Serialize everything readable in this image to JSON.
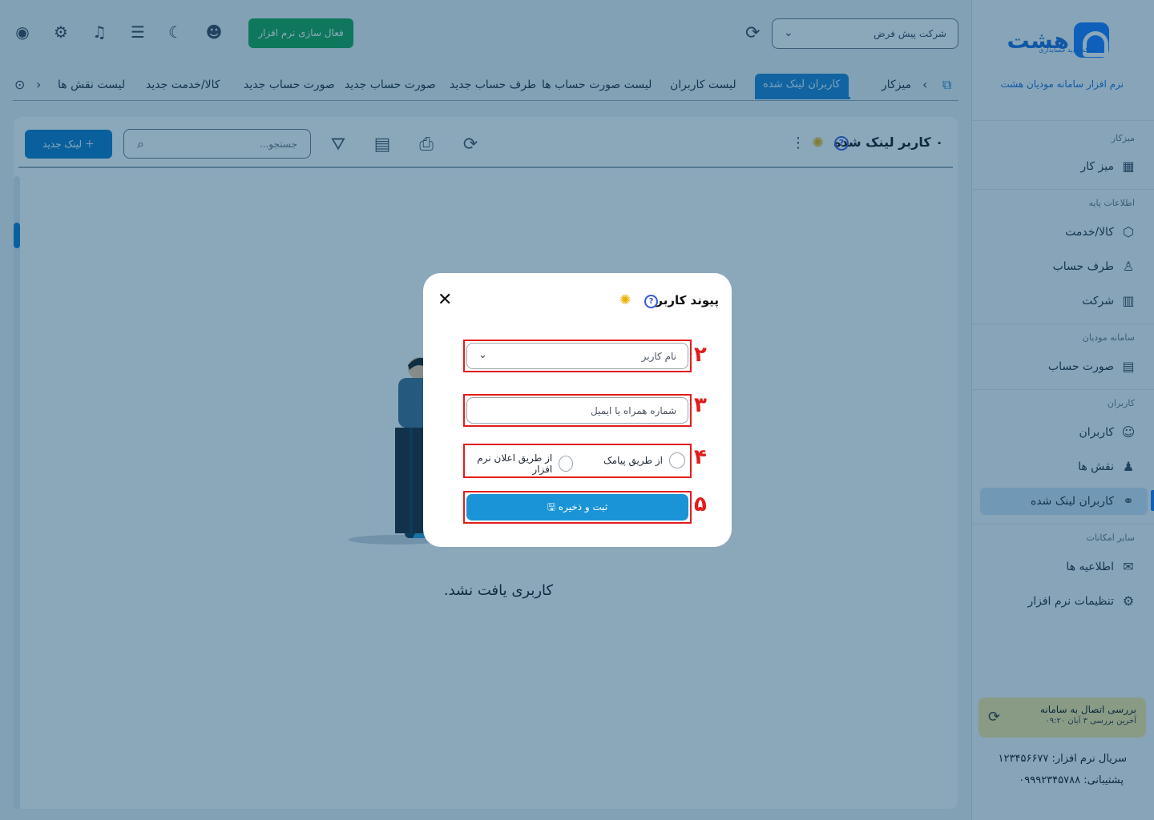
{
  "sidebar": {
    "brand_text": "هشت",
    "brand_sub": "شبکه جدید حسابداری",
    "tagline": "نرم افزار سامانه مودیان هشت",
    "sections": {
      "desk": "میزکار",
      "base": "اطلاعات پایه",
      "moadian": "سامانه مودیان",
      "users": "کاربران",
      "other": "سایر امکانات"
    },
    "items": {
      "workdesk": "میز کار",
      "goods": "کالا/خدمت",
      "party": "طرف حساب",
      "company": "شرکت",
      "invoice": "صورت حساب",
      "users": "کاربران",
      "roles": "نقش ها",
      "linked_users": "کاربران لینک شده",
      "notices": "اطلاعیه ها",
      "settings": "تنظیمات نرم افزار"
    },
    "connection": {
      "title": "بررسی اتصال به سامانه",
      "last_check": "آخرین بررسی ۳ آبان ۰۹:۲۰"
    },
    "serial": "سریال نرم افزار: ۱۲۳۴۵۶۶۷۷",
    "support": "پشتیبانی: ۰۹۹۹۲۳۴۵۷۸۸"
  },
  "topbar": {
    "company_select": "شرکت پیش فرض",
    "activate_label": "فعال سازی نرم افزار"
  },
  "tabs": {
    "t1": "میزکار",
    "t2": "کاربران لینک شده",
    "t3": "لیست کاربران",
    "t4": "لیست صورت حساب ها",
    "t5": "طرف حساب جدید",
    "t6": "صورت حساب جدید",
    "t7": "صورت حساب جدید",
    "t8": "کالا/خدمت جدید",
    "t9": "لیست نقش ها"
  },
  "content": {
    "title": "۰ کاربر لینک شده",
    "search_placeholder": "جستجو...",
    "new_link_label": "لینک جدید",
    "empty_text": "کاربری یافت نشد."
  },
  "modal": {
    "title": "پیوند کاربر",
    "username_placeholder": "نام کاربر",
    "contact_placeholder": "شماره همراه یا ایمیل",
    "radio_sms": "از طریق پیامک",
    "radio_notify": "از طریق اعلان نرم افزار",
    "save_label": "ثبت و ذخیره",
    "step_numbers": [
      "۲",
      "۳",
      "۴",
      "۵"
    ]
  },
  "colors": {
    "primary": "#1a7fcf",
    "highlight": "#e11d1d",
    "activate": "#16a34a",
    "connection_bg": "#fce79a"
  }
}
